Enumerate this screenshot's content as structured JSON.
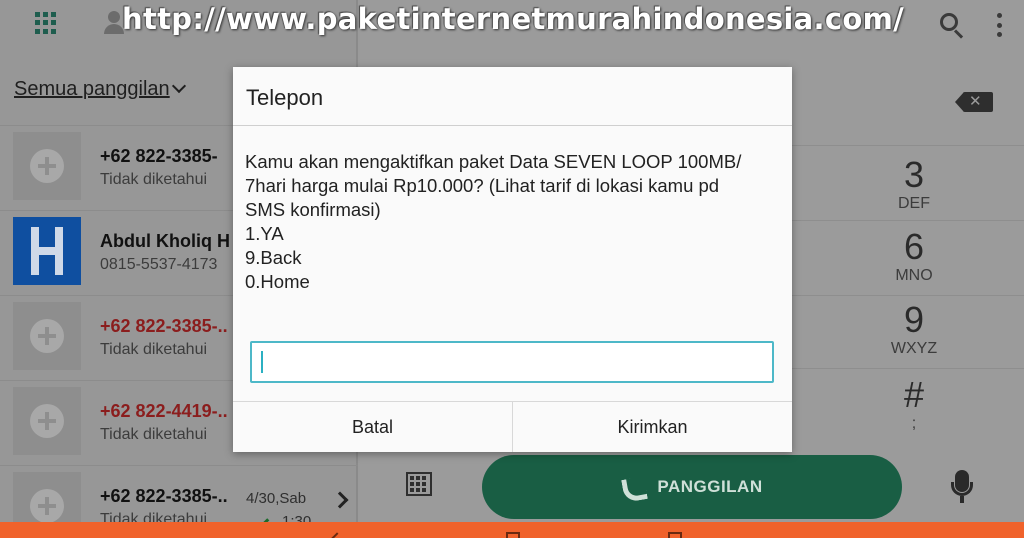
{
  "watermark": "http://www.paketinternetmurahindonesia.com/",
  "call_log": {
    "filter_label": "Semua panggilan",
    "entries": [
      {
        "name": "+62 822-3385-",
        "subtitle": "Tidak diketahui",
        "missed": false
      },
      {
        "name": "Abdul Kholiq H",
        "subtitle": "0815-5537-4173",
        "missed": false
      },
      {
        "name": "+62 822-3385-..",
        "subtitle": "Tidak diketahui",
        "missed": true
      },
      {
        "name": "+62 822-4419-..",
        "subtitle": "Tidak diketahui",
        "missed": true
      },
      {
        "name": "+62 822-3385-..",
        "subtitle": "Tidak diketahui",
        "missed": false,
        "time": "4/30,Sab",
        "duration": "1:30"
      }
    ]
  },
  "dialpad": {
    "keys": [
      {
        "digit": "3",
        "letters": "DEF"
      },
      {
        "digit": "6",
        "letters": "MNO"
      },
      {
        "digit": "9",
        "letters": "WXYZ"
      },
      {
        "digit": "#",
        "letters": ";"
      }
    ],
    "call_button_label": "PANGGILAN"
  },
  "dialog": {
    "title": "Telepon",
    "message_lines": [
      "Kamu akan mengaktifkan paket Data SEVEN LOOP 100MB/",
      "7hari harga mulai Rp10.000? (Lihat tarif di lokasi kamu pd",
      "SMS konfirmasi)",
      "1.YA",
      "9.Back",
      "0.Home"
    ],
    "input_value": "",
    "cancel_label": "Batal",
    "send_label": "Kirimkan"
  },
  "colors": {
    "nav_bar": "#f0622b",
    "call_button": "#195e44",
    "input_focus": "#4db8c8"
  },
  "icons": [
    "apps-grid-icon",
    "contact-icon",
    "search-icon",
    "more-vert-icon",
    "backspace-icon",
    "dialpad-icon",
    "phone-icon",
    "mic-icon",
    "add-contact-icon",
    "chevron-right-icon"
  ]
}
